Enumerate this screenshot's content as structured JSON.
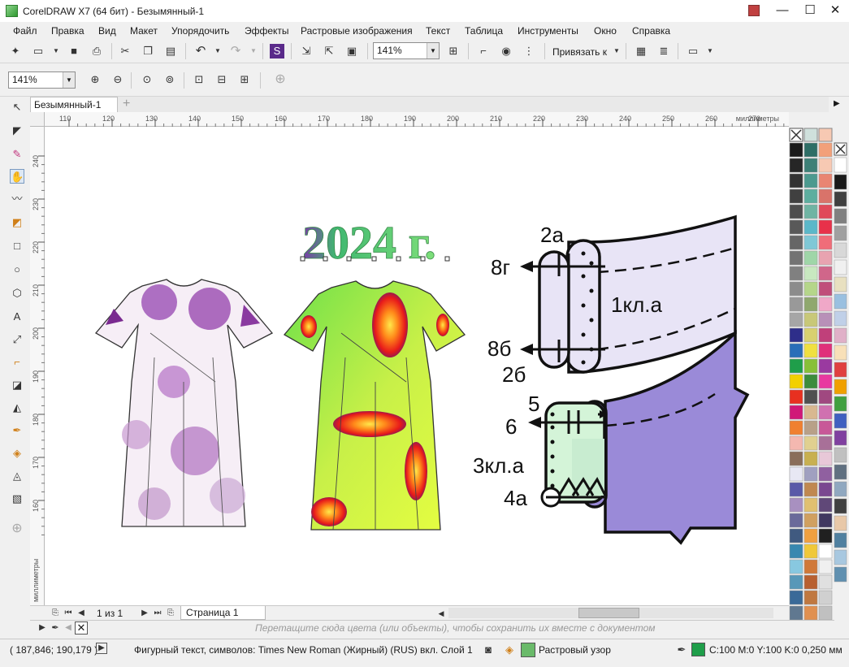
{
  "window": {
    "title": "CorelDRAW X7 (64 бит) - Безымянный-1",
    "minimize": "—",
    "restore": "☐",
    "close": "✕"
  },
  "menu": [
    "Файл",
    "Правка",
    "Вид",
    "Макет",
    "Упорядочить",
    "Эффекты",
    "Растровые изображения",
    "Текст",
    "Таблица",
    "Инструменты",
    "Окно",
    "Справка"
  ],
  "standard_toolbar": {
    "zoom_level": "141%",
    "snap_label": "Привязать к"
  },
  "zoom_toolbar": {
    "zoom_level": "141%"
  },
  "document_tab": "Безымянный-1",
  "ruler": {
    "h_ticks": [
      "110",
      "120",
      "130",
      "140",
      "150",
      "160",
      "170",
      "180",
      "190",
      "200",
      "210",
      "220",
      "230",
      "240",
      "250",
      "260",
      "270"
    ],
    "h_unit": "миллиметры",
    "v_ticks": [
      "240",
      "230",
      "220",
      "210",
      "200",
      "190",
      "180",
      "170",
      "160"
    ],
    "v_unit": "миллиметры"
  },
  "drawing": {
    "year_text": "2024 г.",
    "labels": [
      "2а",
      "8г",
      "1кл.а",
      "8б",
      "2б",
      "5",
      "6",
      "3кл.а",
      "4а"
    ]
  },
  "page_nav": {
    "page_counter": "1 из 1",
    "page_tab": "Страница 1"
  },
  "doc_palette_hint": "Перетащите сюда цвета (или объекты), чтобы сохранить их вместе с документом",
  "status": {
    "coordinates": "( 187,846; 190,179 )",
    "object_info": "Фигурный текст, символов: Times New Roman (Жирный) (RUS) вкл. Слой 1",
    "fill_label": "Растровый узор",
    "outline_info": "C:100 M:0 Y:100 K:0  0,250 мм",
    "outline_color": "#1f9e4a"
  },
  "palette_colors": [
    [
      "#1a1a1a",
      "#2e6e66",
      "#f2a07a"
    ],
    [
      "#262626",
      "#3d8077",
      "#f7c9b3"
    ],
    [
      "#333333",
      "#4c9a8f",
      "#e98572"
    ],
    [
      "#404040",
      "#5dae9f",
      "#d9736a"
    ],
    [
      "#4d4d4d",
      "#6fb4a3",
      "#e04a5a"
    ],
    [
      "#595959",
      "#5bb8c9",
      "#e8314a"
    ],
    [
      "#666666",
      "#7fc8d6",
      "#f06d79"
    ],
    [
      "#737373",
      "#9fd6a8",
      "#e8a3b0"
    ],
    [
      "#808080",
      "#c8e8c0",
      "#d0668a"
    ],
    [
      "#8c8c8c",
      "#b5d68a",
      "#c04e7a"
    ],
    [
      "#999999",
      "#8fa86e",
      "#f0a8c8"
    ],
    [
      "#a6a6a6",
      "#c8c878",
      "#b890b8"
    ],
    [
      "#2e2e8a",
      "#d8d070",
      "#c0407a"
    ],
    [
      "#2a6eb8",
      "#f0e040",
      "#e0307a"
    ],
    [
      "#1f9e4a",
      "#88c038",
      "#9a3aa0"
    ],
    [
      "#f2d000",
      "#3c8c3c",
      "#e838a0"
    ],
    [
      "#e83020",
      "#505050",
      "#a04880"
    ],
    [
      "#d01878",
      "#d8b890",
      "#d070b0"
    ],
    [
      "#f08030",
      "#b8a088",
      "#c85898"
    ],
    [
      "#f4b8b0",
      "#e0d090",
      "#a87098"
    ],
    [
      "#8a6e5a",
      "#c8b050",
      "#e8c8d8"
    ],
    [
      "#e8e8f4",
      "#a0a0c0",
      "#9060a0"
    ],
    [
      "#5a5aa8",
      "#c08850",
      "#7a4890"
    ],
    [
      "#a890c0",
      "#e0c070",
      "#604878"
    ],
    [
      "#6a6a9a",
      "#d0a060",
      "#403860"
    ],
    [
      "#405a80",
      "#f0a040",
      "#202020"
    ],
    [
      "#3888b0",
      "#f0c838",
      "#ffffff"
    ],
    [
      "#88c8e0",
      "#d07838",
      "#f0f0f0"
    ],
    [
      "#5898b8",
      "#b86030",
      "#e0e0e0"
    ],
    [
      "#3a6a98",
      "#c07840",
      "#d0d0d0"
    ],
    [
      "#607890",
      "#e09050",
      "#c0c0c0"
    ]
  ],
  "palette_extra": [
    "#ffffff",
    "#1a1a1a",
    "#404040",
    "#808080",
    "#a0a0a0",
    "#d8d8d8",
    "#f0f0f0",
    "#e8e0c0",
    "#9ac0e0",
    "#c0d0e8",
    "#e0b0c8",
    "#f8e0b8",
    "#e04040",
    "#f0a000",
    "#40a040",
    "#4060c0",
    "#8040a0",
    "#c0c0c0",
    "#607080",
    "#90a8c0",
    "#404040",
    "#e8c8a8",
    "#5080a0",
    "#a8c8e0",
    "#6090b0"
  ]
}
